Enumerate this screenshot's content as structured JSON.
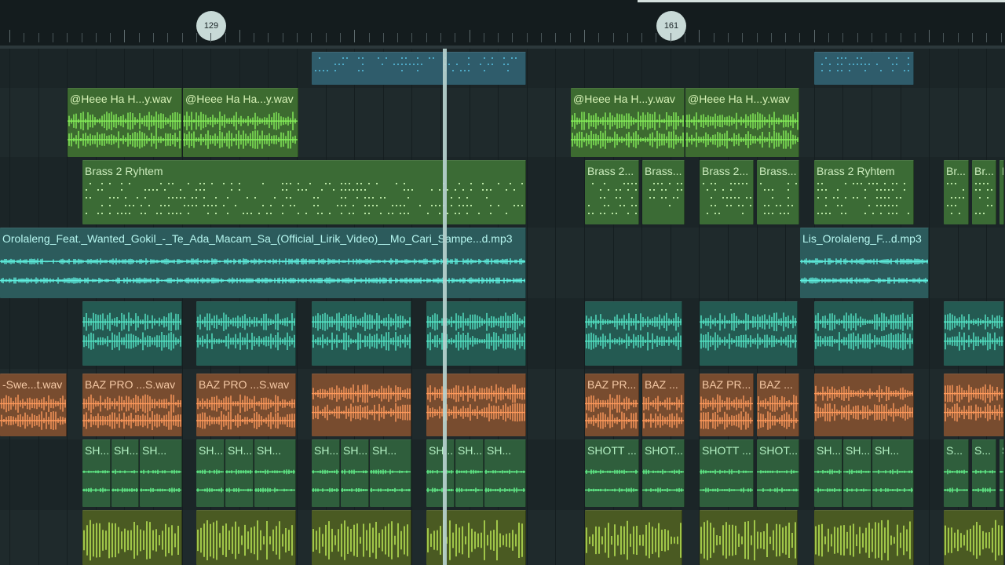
{
  "timeline": {
    "bar_markers": [
      "129",
      "161"
    ]
  },
  "tracks": [
    {
      "id": "row0",
      "kind": "pattern",
      "colors": {
        "fill": "#2f5c6b",
        "line": "#4ea9c6"
      },
      "clips": [
        {
          "name": "",
          "start": 397,
          "end": 671
        },
        {
          "name": "",
          "start": 1037,
          "end": 1165
        }
      ]
    },
    {
      "id": "row1",
      "kind": "audio",
      "colors": {
        "fill": "#3d6b30",
        "text": "#d6f2b6",
        "line": "#86f05a"
      },
      "clips": [
        {
          "name": "@Heee Ha H...y.wav",
          "start": 86,
          "end": 233
        },
        {
          "name": "@Heee Ha Ha...y.wav",
          "start": 233,
          "end": 381
        },
        {
          "name": "@Heee Ha H...y.wav",
          "start": 727,
          "end": 873
        },
        {
          "name": "@Heee Ha H...y.wav",
          "start": 873,
          "end": 1019
        }
      ]
    },
    {
      "id": "row2",
      "kind": "pattern",
      "colors": {
        "fill": "#3b6b35",
        "text": "#ccecbd",
        "line": "#b9e5a4"
      },
      "clips": [
        {
          "name": "Brass 2 Ryhtem",
          "start": 105,
          "end": 671
        },
        {
          "name": "Brass 2...",
          "start": 745,
          "end": 815
        },
        {
          "name": "Brass...",
          "start": 818,
          "end": 873
        },
        {
          "name": "Brass 2...",
          "start": 891,
          "end": 961
        },
        {
          "name": "Brass...",
          "start": 964,
          "end": 1019
        },
        {
          "name": "Brass 2 Ryhtem",
          "start": 1037,
          "end": 1165
        },
        {
          "name": "Br...",
          "start": 1202,
          "end": 1235
        },
        {
          "name": "Br...",
          "start": 1238,
          "end": 1270
        },
        {
          "name": "Br...",
          "start": 1273,
          "end": 1280
        }
      ]
    },
    {
      "id": "row3",
      "kind": "audio",
      "colors": {
        "fill": "#2c5b5c",
        "text": "#b6f7f0",
        "line": "#5ff0df"
      },
      "clips": [
        {
          "name": "Orolaleng_Feat._Wanted_Gokil_-_Te_Ada_Macam_Sa_(Official_Lirik_Video)__Mo_Cari_Sampe...d.mp3",
          "start": 0,
          "end": 671
        },
        {
          "name": "Lis_Orolaleng_F...d.mp3",
          "start": 1019,
          "end": 1184
        }
      ]
    },
    {
      "id": "row4",
      "kind": "audio",
      "colors": {
        "fill": "#245a52",
        "text": "#a8f0e2",
        "line": "#55e7c7"
      },
      "clips": [
        {
          "name": "",
          "start": 105,
          "end": 233
        },
        {
          "name": "",
          "start": 250,
          "end": 378
        },
        {
          "name": "",
          "start": 397,
          "end": 525
        },
        {
          "name": "",
          "start": 543,
          "end": 671
        },
        {
          "name": "",
          "start": 745,
          "end": 870
        },
        {
          "name": "",
          "start": 891,
          "end": 1017
        },
        {
          "name": "",
          "start": 1037,
          "end": 1165
        },
        {
          "name": "",
          "start": 1202,
          "end": 1280
        }
      ]
    },
    {
      "id": "row5",
      "kind": "audio",
      "colors": {
        "fill": "#784c2f",
        "text": "#f5c9a5",
        "line": "#ff9a5c"
      },
      "clips": [
        {
          "name": "-Swe...t.wav",
          "start": 0,
          "end": 86
        },
        {
          "name": "BAZ PRO ...S.wav",
          "start": 105,
          "end": 233
        },
        {
          "name": "BAZ PRO ...S.wav",
          "start": 250,
          "end": 378
        },
        {
          "name": "",
          "start": 397,
          "end": 525
        },
        {
          "name": "",
          "start": 543,
          "end": 671
        },
        {
          "name": "BAZ PR...",
          "start": 745,
          "end": 815
        },
        {
          "name": "BAZ ...",
          "start": 818,
          "end": 873
        },
        {
          "name": "BAZ PR...",
          "start": 891,
          "end": 961
        },
        {
          "name": "BAZ ...",
          "start": 964,
          "end": 1019
        },
        {
          "name": "",
          "start": 1037,
          "end": 1165
        },
        {
          "name": "",
          "start": 1202,
          "end": 1280
        }
      ]
    },
    {
      "id": "row6",
      "kind": "audio",
      "colors": {
        "fill": "#2f5e3c",
        "text": "#b5f2c4",
        "line": "#62f08a"
      },
      "clips": [
        {
          "name": "SH...",
          "start": 105,
          "end": 142
        },
        {
          "name": "SH...",
          "start": 142,
          "end": 178
        },
        {
          "name": "SH...",
          "start": 178,
          "end": 233
        },
        {
          "name": "SH...",
          "start": 250,
          "end": 287
        },
        {
          "name": "SH...",
          "start": 287,
          "end": 324
        },
        {
          "name": "SH...",
          "start": 324,
          "end": 378
        },
        {
          "name": "SH...",
          "start": 397,
          "end": 434
        },
        {
          "name": "SH...",
          "start": 434,
          "end": 471
        },
        {
          "name": "SH...",
          "start": 471,
          "end": 525
        },
        {
          "name": "SH...",
          "start": 543,
          "end": 580
        },
        {
          "name": "SH...",
          "start": 580,
          "end": 617
        },
        {
          "name": "SH...",
          "start": 617,
          "end": 671
        },
        {
          "name": "SHOTT ...",
          "start": 745,
          "end": 815
        },
        {
          "name": "SHOT...",
          "start": 818,
          "end": 873
        },
        {
          "name": "SHOTT ...",
          "start": 891,
          "end": 961
        },
        {
          "name": "SHOT...",
          "start": 964,
          "end": 1019
        },
        {
          "name": "SH...",
          "start": 1037,
          "end": 1074
        },
        {
          "name": "SH...",
          "start": 1074,
          "end": 1111
        },
        {
          "name": "SH...",
          "start": 1111,
          "end": 1165
        },
        {
          "name": "S...",
          "start": 1202,
          "end": 1235
        },
        {
          "name": "S...",
          "start": 1238,
          "end": 1270
        },
        {
          "name": "S...",
          "start": 1273,
          "end": 1280
        }
      ]
    },
    {
      "id": "row7",
      "kind": "audio",
      "colors": {
        "fill": "#4a5a22",
        "text": "#e0f0a8",
        "line": "#c6f45a"
      },
      "clips": [
        {
          "name": "",
          "start": 105,
          "end": 233
        },
        {
          "name": "",
          "start": 250,
          "end": 378
        },
        {
          "name": "",
          "start": 397,
          "end": 525
        },
        {
          "name": "",
          "start": 543,
          "end": 671
        },
        {
          "name": "",
          "start": 745,
          "end": 870
        },
        {
          "name": "",
          "start": 891,
          "end": 1017
        },
        {
          "name": "",
          "start": 1037,
          "end": 1165
        },
        {
          "name": "",
          "start": 1202,
          "end": 1280
        }
      ]
    }
  ],
  "theme": {
    "background": "#1c2628",
    "ruler": "#141c1e",
    "playhead": "#b7d2cf",
    "marker_bg": "#c8dad7"
  }
}
